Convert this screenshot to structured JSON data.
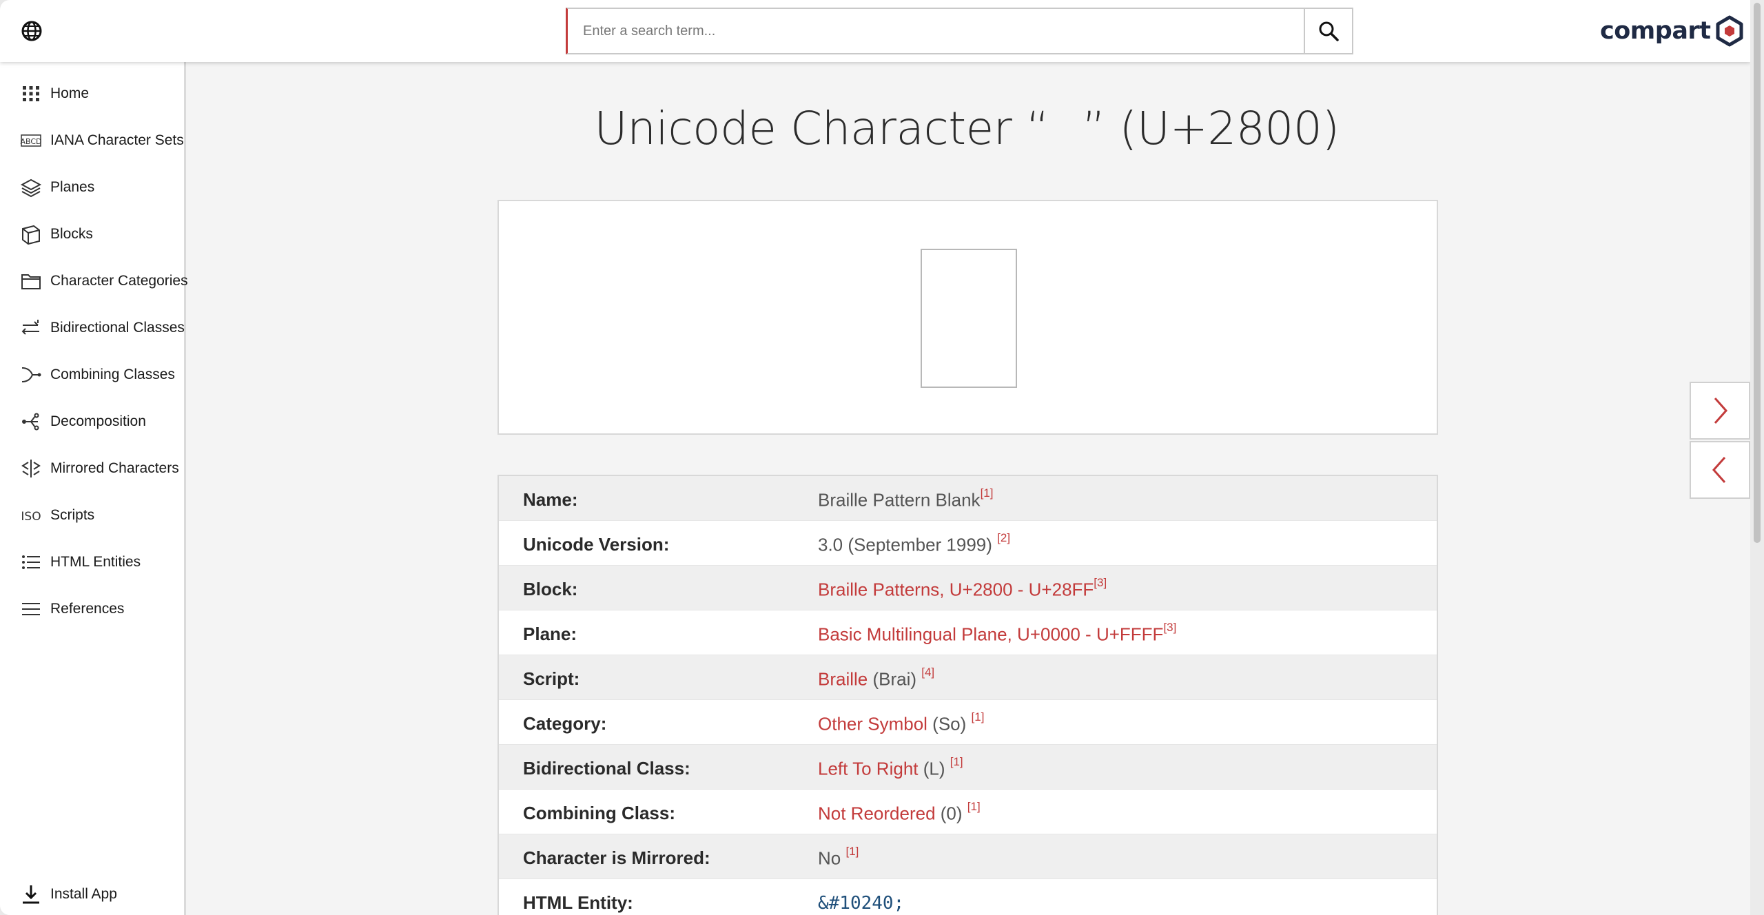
{
  "search": {
    "placeholder": "Enter a search term..."
  },
  "brand": {
    "name": "compart"
  },
  "sidebar": {
    "items": [
      {
        "label": "Home",
        "icon": "grid-icon"
      },
      {
        "label": "IANA Character Sets",
        "icon": "abcd-icon"
      },
      {
        "label": "Planes",
        "icon": "layers-icon"
      },
      {
        "label": "Blocks",
        "icon": "cube-icon"
      },
      {
        "label": "Character Categories",
        "icon": "folder-icon"
      },
      {
        "label": "Bidirectional Classes",
        "icon": "bidi-arrows-icon"
      },
      {
        "label": "Combining Classes",
        "icon": "combine-icon"
      },
      {
        "label": "Decomposition",
        "icon": "decomposition-icon"
      },
      {
        "label": "Mirrored Characters",
        "icon": "mirror-icon"
      },
      {
        "label": "Scripts",
        "icon": "iso-icon"
      },
      {
        "label": "HTML Entities",
        "icon": "list-icon"
      },
      {
        "label": "References",
        "icon": "menu-icon"
      }
    ],
    "install_label": "Install App"
  },
  "page": {
    "title": "Unicode Character “⠀” (U+2800)",
    "glyph": "⠀"
  },
  "properties": [
    {
      "key": "Name:",
      "value": "Braille Pattern Blank",
      "link": "",
      "suffix": "",
      "ref": "[1]"
    },
    {
      "key": "Unicode Version:",
      "value": "3.0 (September 1999)",
      "link": "",
      "suffix": "",
      "ref": "[2]"
    },
    {
      "key": "Block:",
      "value": "",
      "link": "Braille Patterns, U+2800 - U+28FF",
      "suffix": "",
      "ref": "[3]"
    },
    {
      "key": "Plane:",
      "value": "",
      "link": "Basic Multilingual Plane, U+0000 - U+FFFF",
      "suffix": "",
      "ref": "[3]"
    },
    {
      "key": "Script:",
      "value": "",
      "link": "Braille",
      "suffix": " (Brai) ",
      "ref": "[4]"
    },
    {
      "key": "Category:",
      "value": "",
      "link": "Other Symbol",
      "suffix": " (So) ",
      "ref": "[1]"
    },
    {
      "key": "Bidirectional Class:",
      "value": "",
      "link": "Left To Right",
      "suffix": " (L) ",
      "ref": "[1]"
    },
    {
      "key": "Combining Class:",
      "value": "",
      "link": "Not Reordered",
      "suffix": " (0) ",
      "ref": "[1]"
    },
    {
      "key": "Character is Mirrored:",
      "value": "No ",
      "link": "",
      "suffix": "",
      "ref": "[1]"
    },
    {
      "key": "HTML Entity:",
      "code": "&#10240;"
    }
  ],
  "colors": {
    "accent": "#c33b3b",
    "code": "#1f4f7a",
    "brand_dark": "#1f2a44"
  }
}
